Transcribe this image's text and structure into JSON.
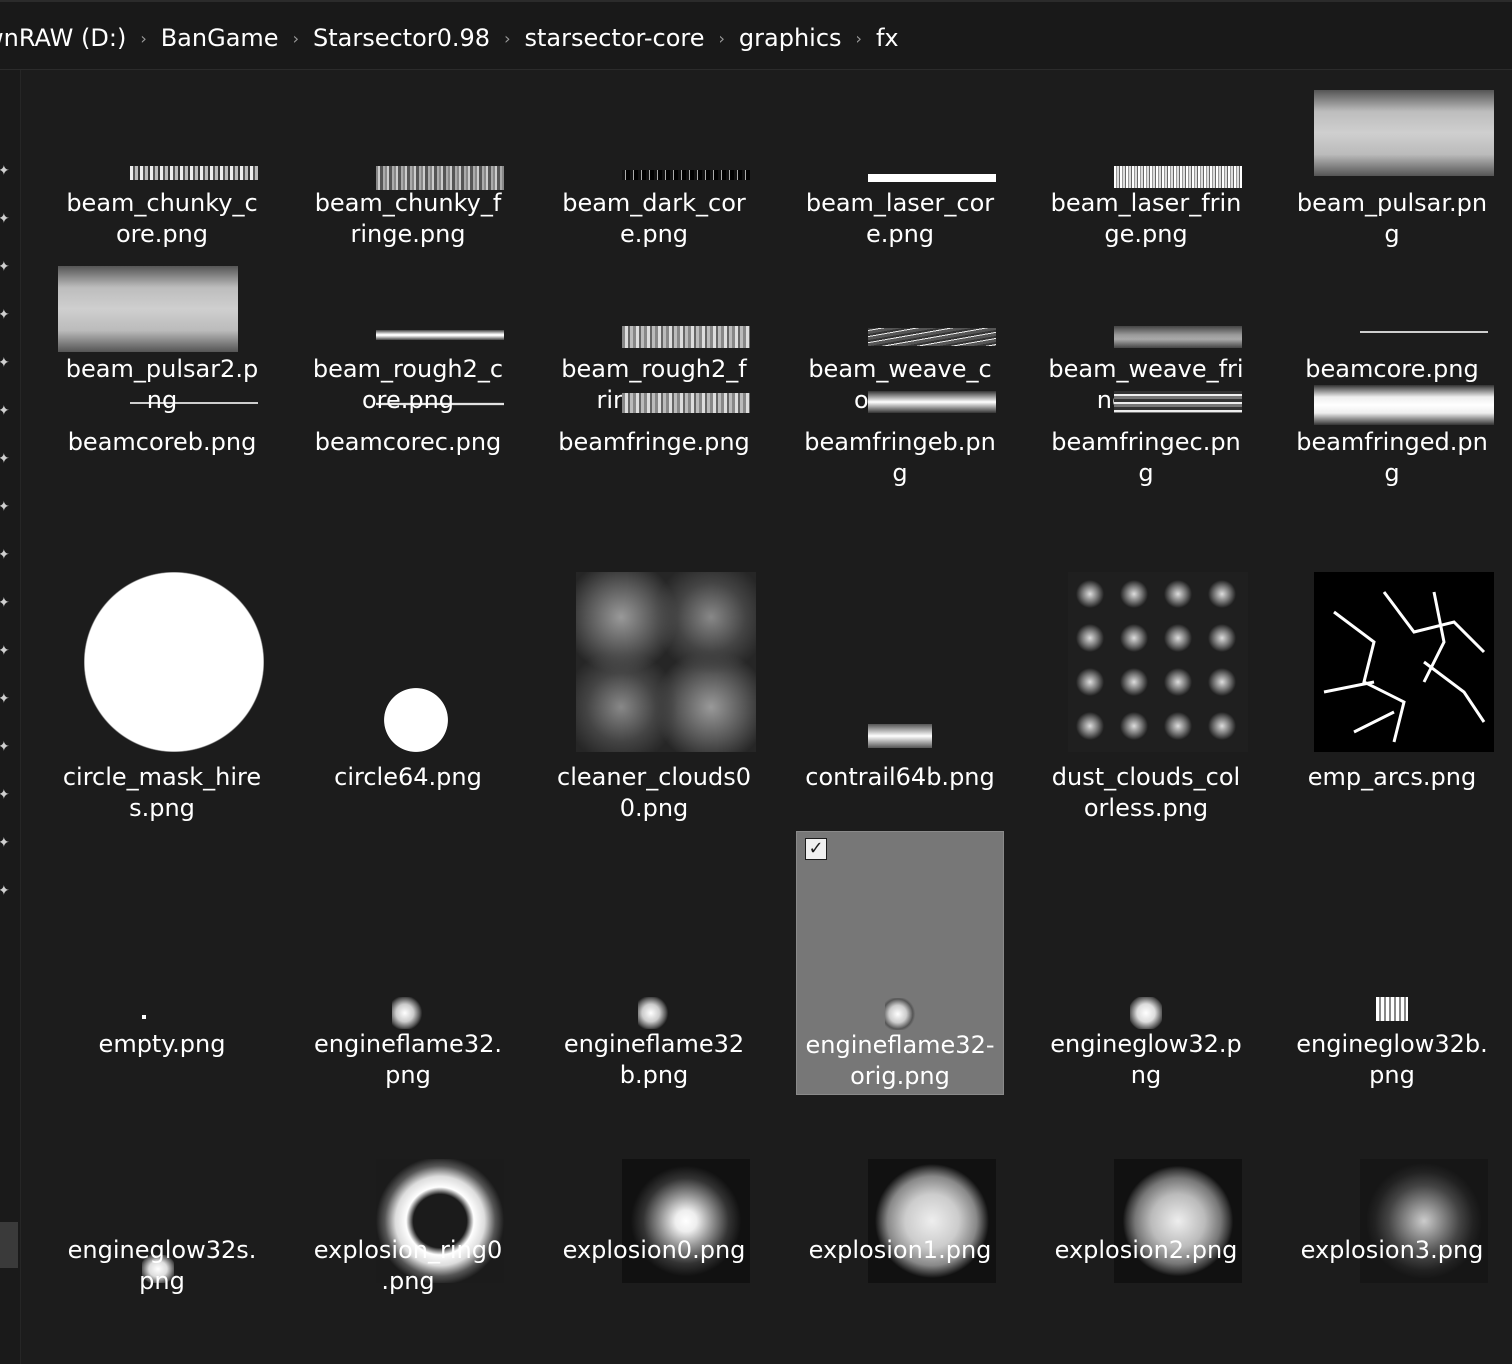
{
  "breadcrumb": {
    "items": [
      "wnRAW (D:)",
      "BanGame",
      "Starsector0.98",
      "starsector-core",
      "graphics",
      "fx"
    ],
    "separator": "›"
  },
  "files": [
    {
      "name": "beam_chunky_core.png",
      "line1": "beam_chunky_c",
      "line2": "ore.png"
    },
    {
      "name": "beam_chunky_fringe.png",
      "line1": "beam_chunky_f",
      "line2": "ringe.png"
    },
    {
      "name": "beam_dark_core.png",
      "line1": "beam_dark_cor",
      "line2": "e.png"
    },
    {
      "name": "beam_laser_core.png",
      "line1": "beam_laser_cor",
      "line2": "e.png"
    },
    {
      "name": "beam_laser_fringe.png",
      "line1": "beam_laser_frin",
      "line2": "ge.png"
    },
    {
      "name": "beam_pulsar.png",
      "line1": "beam_pulsar.pn",
      "line2": "g"
    },
    {
      "name": "beam_pulsar2.png",
      "line1": "beam_pulsar2.p",
      "line2": "ng"
    },
    {
      "name": "beam_rough2_core.png",
      "line1": "beam_rough2_c",
      "line2": "ore.png"
    },
    {
      "name": "beam_rough2_fringe.png",
      "line1": "beam_rough2_f",
      "line2": "ringe.png"
    },
    {
      "name": "beam_weave_core.png",
      "line1": "beam_weave_c",
      "line2": "ore.png"
    },
    {
      "name": "beam_weave_fringe.png",
      "line1": "beam_weave_fri",
      "line2": "nge.png"
    },
    {
      "name": "beamcore.png",
      "line1": "beamcore.png",
      "line2": ""
    },
    {
      "name": "beamcoreb.png",
      "line1": "beamcoreb.png",
      "line2": ""
    },
    {
      "name": "beamcorec.png",
      "line1": "beamcorec.png",
      "line2": ""
    },
    {
      "name": "beamfringe.png",
      "line1": "beamfringe.png",
      "line2": ""
    },
    {
      "name": "beamfringeb.png",
      "line1": "beamfringeb.pn",
      "line2": "g"
    },
    {
      "name": "beamfringec.png",
      "line1": "beamfringec.pn",
      "line2": "g"
    },
    {
      "name": "beamfringed.png",
      "line1": "beamfringed.pn",
      "line2": "g"
    },
    {
      "name": "circle_mask_hires.png",
      "line1": "circle_mask_hire",
      "line2": "s.png"
    },
    {
      "name": "circle64.png",
      "line1": "circle64.png",
      "line2": ""
    },
    {
      "name": "cleaner_clouds00.png",
      "line1": "cleaner_clouds0",
      "line2": "0.png"
    },
    {
      "name": "contrail64b.png",
      "line1": "contrail64b.png",
      "line2": ""
    },
    {
      "name": "dust_clouds_colorless.png",
      "line1": "dust_clouds_col",
      "line2": "orless.png"
    },
    {
      "name": "emp_arcs.png",
      "line1": "emp_arcs.png",
      "line2": ""
    },
    {
      "name": "empty.png",
      "line1": "empty.png",
      "line2": ""
    },
    {
      "name": "engineflame32.png",
      "line1": "engineflame32.",
      "line2": "png"
    },
    {
      "name": "engineflame32b.png",
      "line1": "engineflame32",
      "line2": "b.png"
    },
    {
      "name": "engineflame32-orig.png",
      "line1": "engineflame32-",
      "line2": "orig.png",
      "selected": true
    },
    {
      "name": "engineglow32.png",
      "line1": "engineglow32.p",
      "line2": "ng"
    },
    {
      "name": "engineglow32b.png",
      "line1": "engineglow32b.",
      "line2": "png"
    },
    {
      "name": "engineglow32s.png",
      "line1": "engineglow32s.",
      "line2": "png"
    },
    {
      "name": "explosion_ring0.png",
      "line1": "explosion_ring0",
      "line2": ".png"
    },
    {
      "name": "explosion0.png",
      "line1": "explosion0.png",
      "line2": ""
    },
    {
      "name": "explosion1.png",
      "line1": "explosion1.png",
      "line2": ""
    },
    {
      "name": "explosion2.png",
      "line1": "explosion2.png",
      "line2": ""
    },
    {
      "name": "explosion3.png",
      "line1": "explosion3.png",
      "line2": ""
    }
  ],
  "selected_checkbox": "✓",
  "icons": {
    "pin": "pin-icon",
    "chevron": "chevron-right-icon"
  }
}
